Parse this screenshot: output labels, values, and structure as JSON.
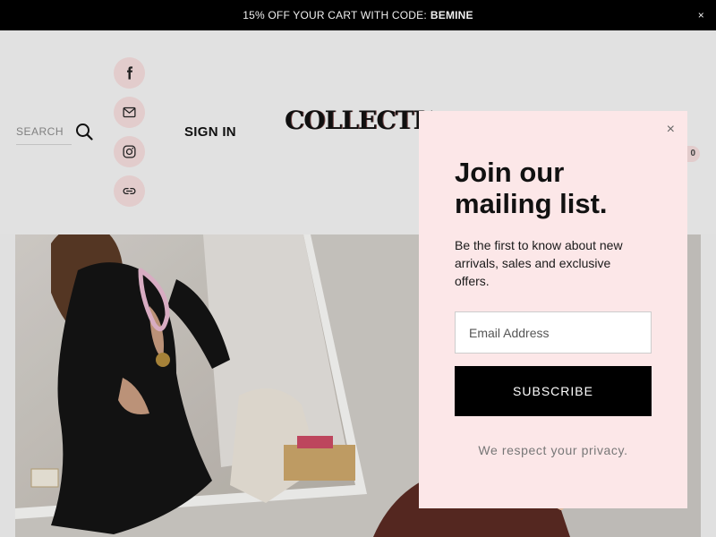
{
  "announcement": {
    "text": "15% OFF YOUR CART WITH CODE:",
    "code": "BEMINE",
    "close": "×"
  },
  "header": {
    "search_placeholder": "SEARCH",
    "signin": "SIGN IN",
    "logo": "COLLECTION",
    "cart_count": "0",
    "social_icons": [
      "facebook-icon",
      "mail-icon",
      "instagram-icon",
      "link-icon"
    ]
  },
  "popup": {
    "close": "×",
    "title": "Join our mailing list.",
    "text": "Be the first to know about new arrivals, sales and exclusive offers.",
    "email_placeholder": "Email Address",
    "button": "SUBSCRIBE",
    "privacy": "We respect your privacy."
  },
  "colors": {
    "announcement_bg": "#000000",
    "accent_pink": "#f1d9d9",
    "popup_bg": "#fce7e8",
    "button_bg": "#000000"
  }
}
